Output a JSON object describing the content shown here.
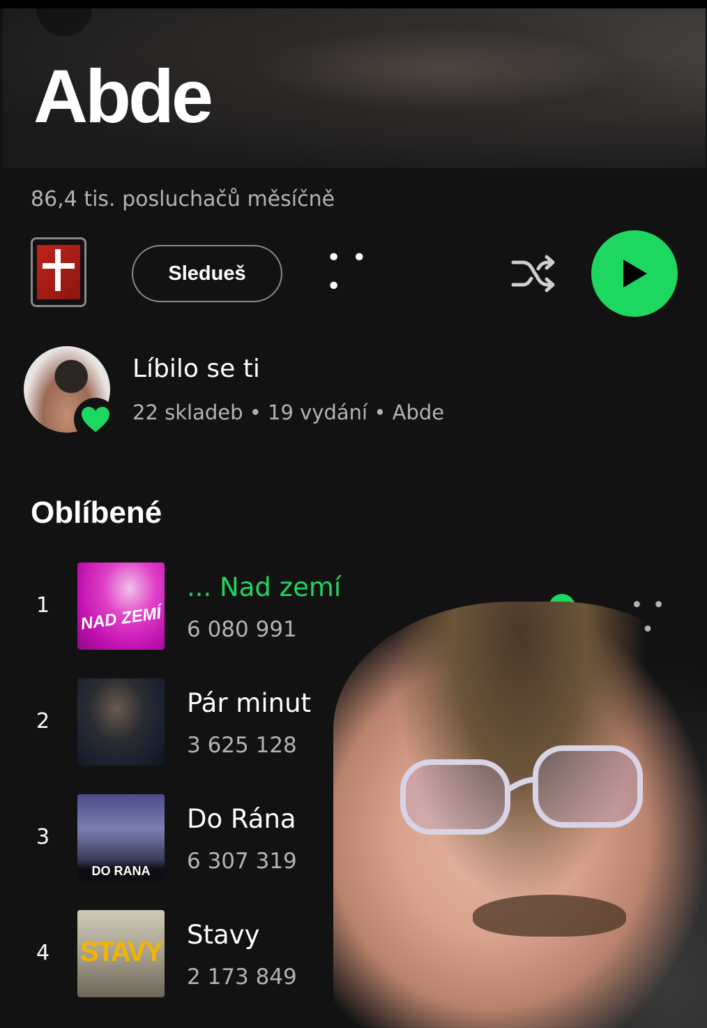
{
  "header": {
    "artist_name": "Abde",
    "monthly_listeners": "86,4 tis. posluchačů měsíčně"
  },
  "actions": {
    "follow_label": "Sledueš",
    "more_label": "• • •",
    "shuffle_icon": "shuffle-icon",
    "play_icon": "play-icon",
    "accent_color": "#1ed760"
  },
  "liked": {
    "title": "Líbilo se ti",
    "subtitle": "22 skladeb • 19 vydání • Abde",
    "badge_icon": "heart-icon"
  },
  "popular": {
    "heading": "Oblíbené",
    "tracks": [
      {
        "rank": "1",
        "title": "... Nad zemí",
        "plays": "6 080 991",
        "playing": true,
        "cover_text": "NAD ZEMÍ"
      },
      {
        "rank": "2",
        "title": "Pár minut",
        "plays": "3 625 128",
        "playing": false,
        "cover_text": ""
      },
      {
        "rank": "3",
        "title": "Do Rána",
        "plays": "6 307 319",
        "playing": false,
        "cover_text": "DO RANA"
      },
      {
        "rank": "4",
        "title": "Stavy",
        "plays": "2 173 849",
        "playing": false,
        "cover_text": "STAVY"
      }
    ],
    "row_more_label": "• • •"
  }
}
